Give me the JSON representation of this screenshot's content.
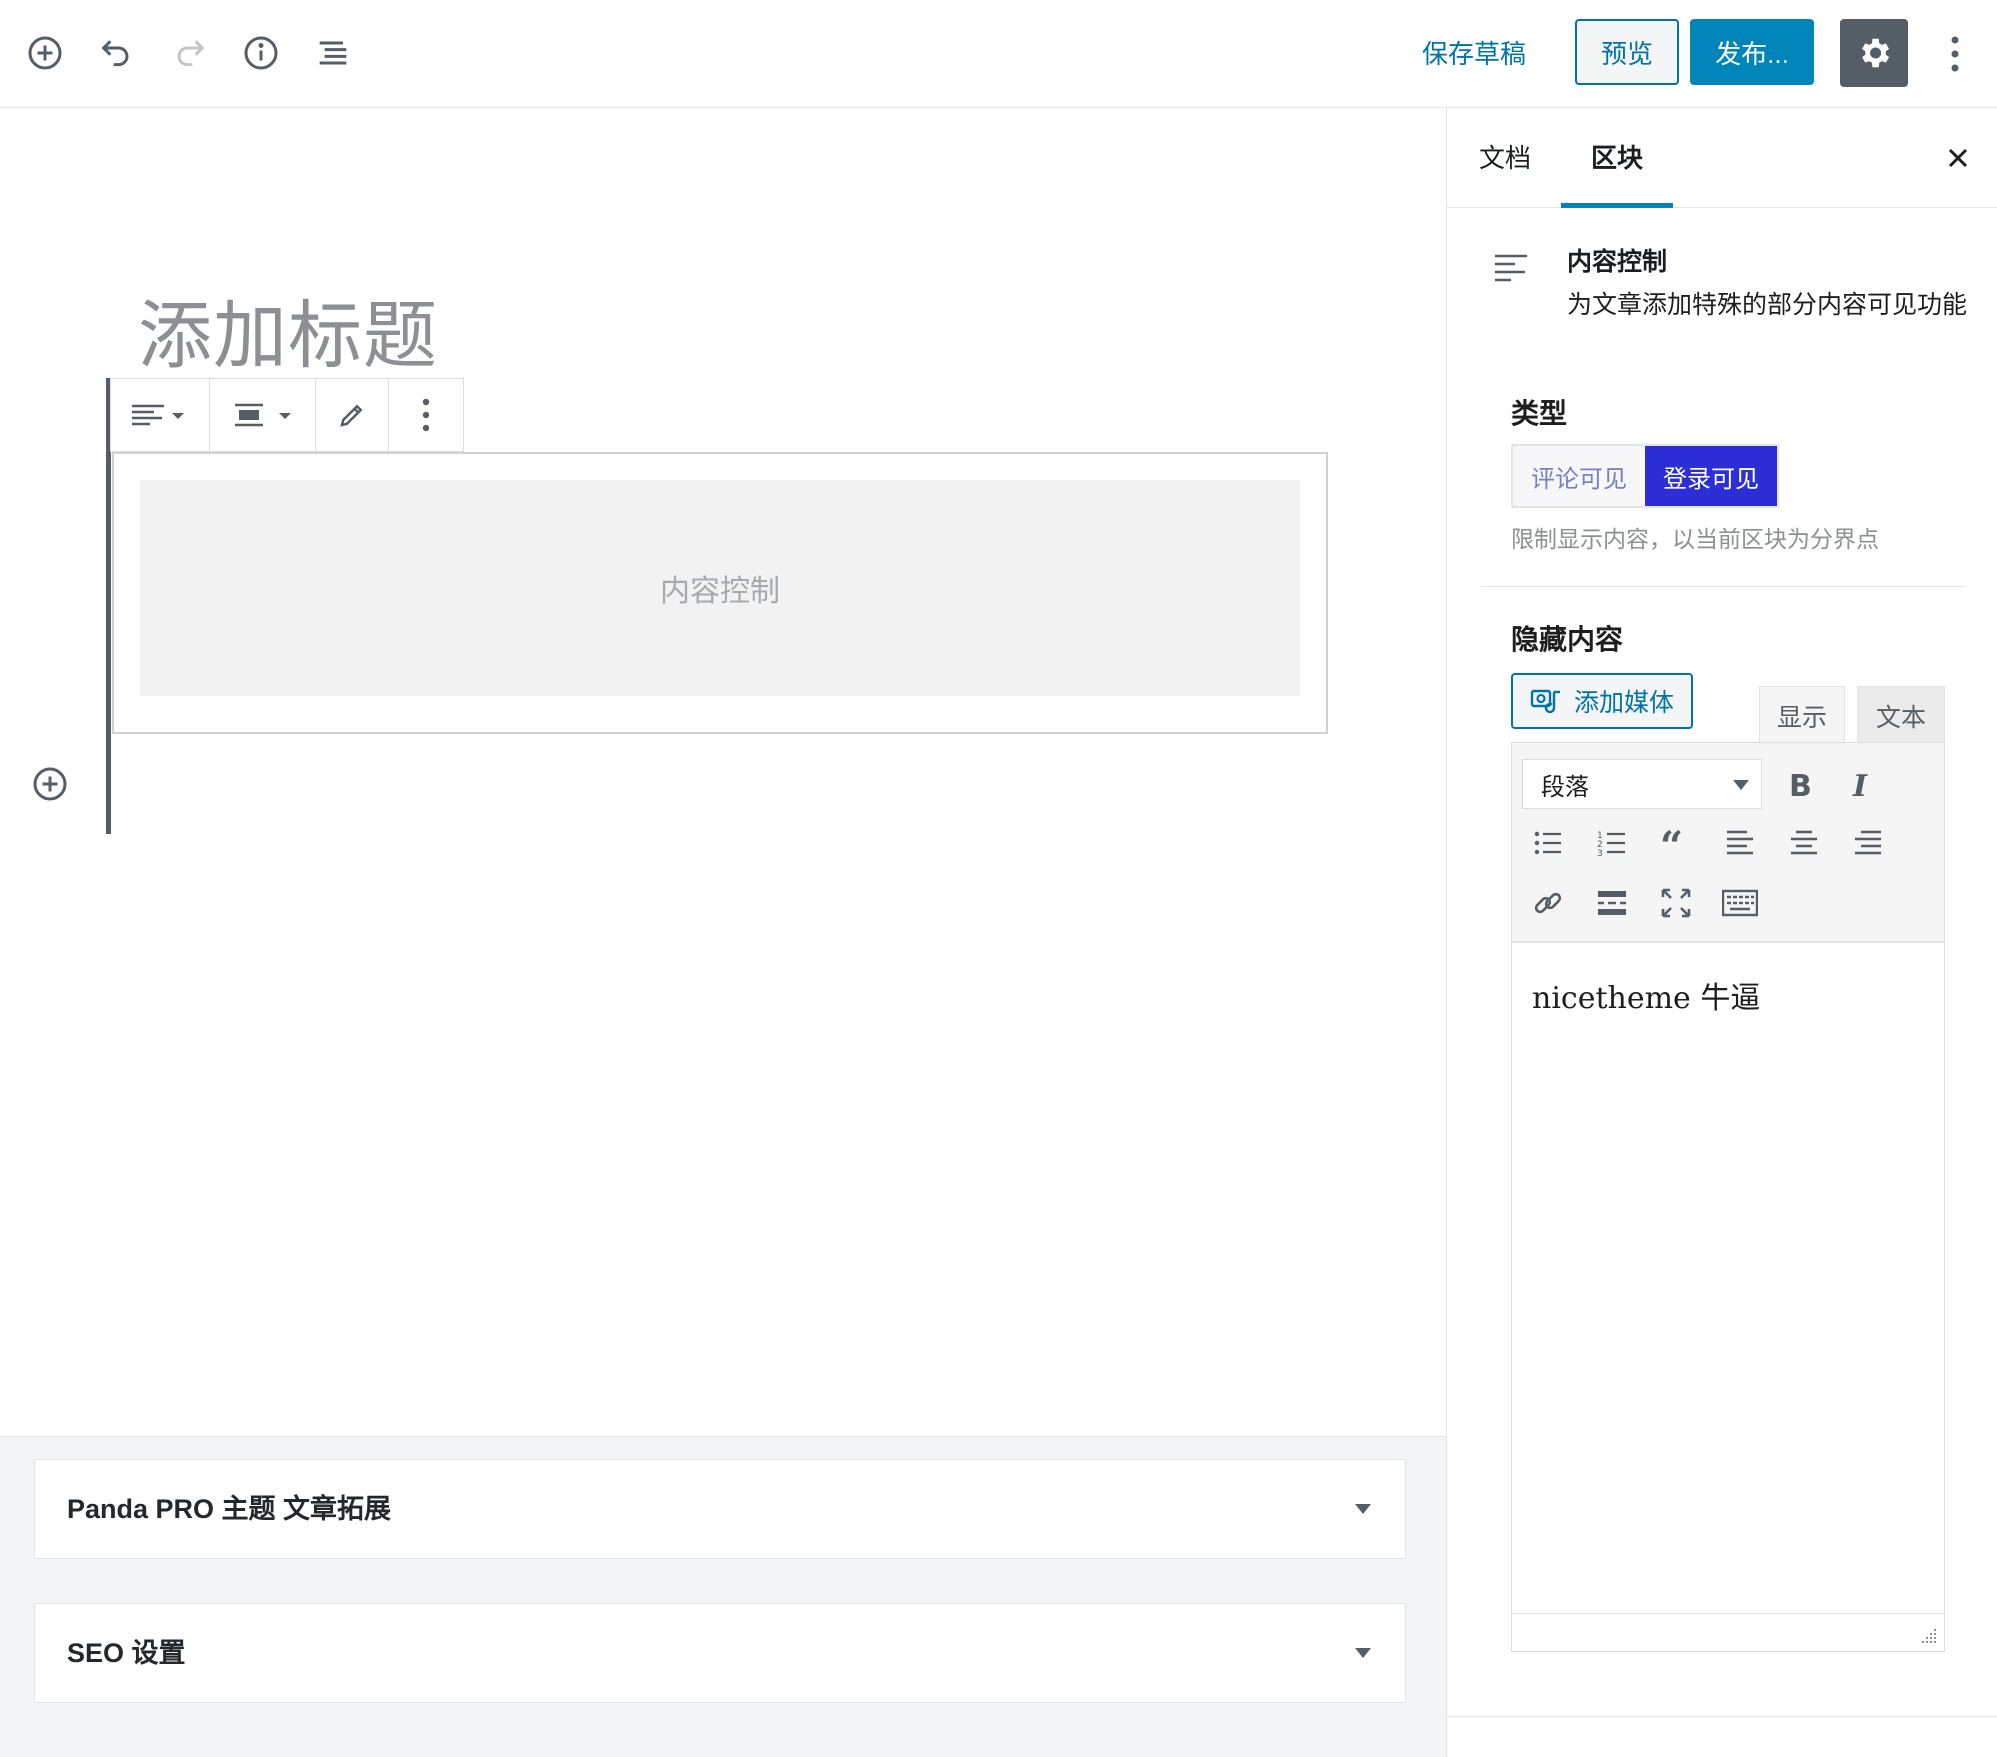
{
  "toolbar": {
    "save_draft": "保存草稿",
    "preview": "预览",
    "publish": "发布..."
  },
  "editor": {
    "title_placeholder": "添加标题",
    "block_placeholder": "内容控制"
  },
  "metaboxes": [
    {
      "title": "Panda PRO 主题 文章拓展"
    },
    {
      "title": "SEO 设置"
    }
  ],
  "sidebar": {
    "tabs": [
      {
        "label": "文档",
        "active": false
      },
      {
        "label": "区块",
        "active": true
      }
    ],
    "block": {
      "name": "内容控制",
      "description": "为文章添加特殊的部分内容可见功能"
    },
    "type_label": "类型",
    "type_options": [
      {
        "label": "评论可见",
        "selected": false
      },
      {
        "label": "登录可见",
        "selected": true
      }
    ],
    "type_help": "限制显示内容，以当前区块为分界点",
    "hidden_label": "隐藏内容",
    "add_media": "添加媒体",
    "mode_tabs": [
      {
        "label": "显示",
        "active": true
      },
      {
        "label": "文本",
        "active": false
      }
    ],
    "format_select": "段落",
    "content": "nicetheme 牛逼"
  },
  "colors": {
    "accent": "#0085ba",
    "link": "#0073aa",
    "selected_segment": "#2c2fd8"
  }
}
